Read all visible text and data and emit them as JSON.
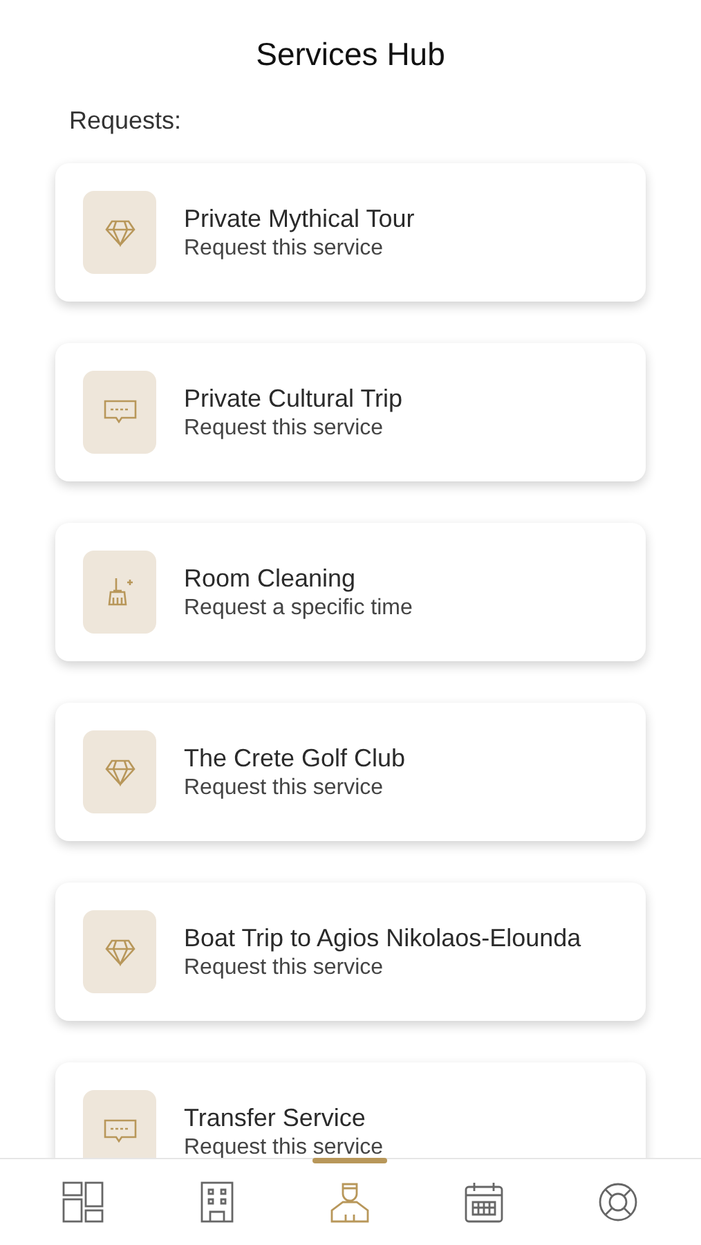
{
  "header": {
    "title": "Services Hub"
  },
  "section_label": "Requests:",
  "services": [
    {
      "kind": "diamond",
      "title": "Private Mythical Tour",
      "subtitle": "Request this service"
    },
    {
      "kind": "taxi",
      "title": "Private Cultural Trip",
      "subtitle": "Request this service"
    },
    {
      "kind": "cleaning",
      "title": "Room Cleaning",
      "subtitle": "Request a specific time"
    },
    {
      "kind": "diamond",
      "title": "The Crete Golf Club",
      "subtitle": "Request this service"
    },
    {
      "kind": "diamond",
      "title": "Boat Trip to Agios Nikolaos-Elounda",
      "subtitle": "Request this service"
    },
    {
      "kind": "taxi",
      "title": "Transfer Service",
      "subtitle": "Request this service"
    }
  ],
  "bottom_nav": [
    {
      "kind": "dashboard",
      "selected": false
    },
    {
      "kind": "hotel",
      "selected": false
    },
    {
      "kind": "concierge",
      "selected": true
    },
    {
      "kind": "calendar",
      "selected": false
    },
    {
      "kind": "lifebuoy",
      "selected": false
    }
  ]
}
